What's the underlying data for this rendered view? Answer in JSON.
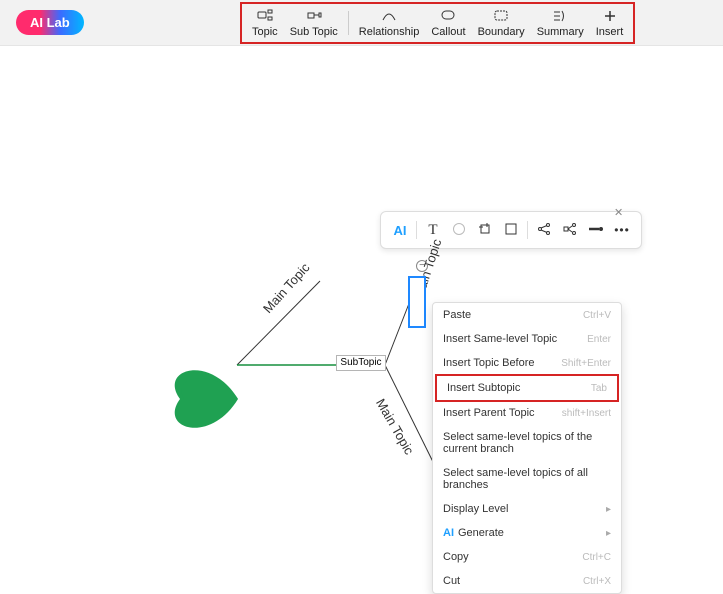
{
  "header": {
    "ai_lab": "AI Lab",
    "toolbar": [
      {
        "label": "Topic"
      },
      {
        "label": "Sub Topic"
      },
      {
        "label": "Relationship"
      },
      {
        "label": "Callout"
      },
      {
        "label": "Boundary"
      },
      {
        "label": "Summary"
      },
      {
        "label": "Insert"
      }
    ]
  },
  "float_tools": {
    "ai": "AI"
  },
  "mindmap": {
    "main_topic_1": "Main Topic",
    "main_topic_2": "Main Topic",
    "main_topic_3": "Main Topic",
    "subtopic": "SubTopic"
  },
  "ctx": {
    "paste": {
      "label": "Paste",
      "sc": "Ctrl+V"
    },
    "same_level": {
      "label": "Insert Same-level Topic",
      "sc": "Enter"
    },
    "before": {
      "label": "Insert Topic Before",
      "sc": "Shift+Enter"
    },
    "subtopic": {
      "label": "Insert Subtopic",
      "sc": "Tab"
    },
    "parent": {
      "label": "Insert Parent Topic",
      "sc": "shift+Insert"
    },
    "sel_cur": {
      "label": "Select same-level topics of the current branch"
    },
    "sel_all": {
      "label": "Select same-level topics of all branches"
    },
    "display": {
      "label": "Display Level"
    },
    "generate": {
      "label": "Generate"
    },
    "copy": {
      "label": "Copy",
      "sc": "Ctrl+C"
    },
    "cut": {
      "label": "Cut",
      "sc": "Ctrl+X"
    }
  }
}
